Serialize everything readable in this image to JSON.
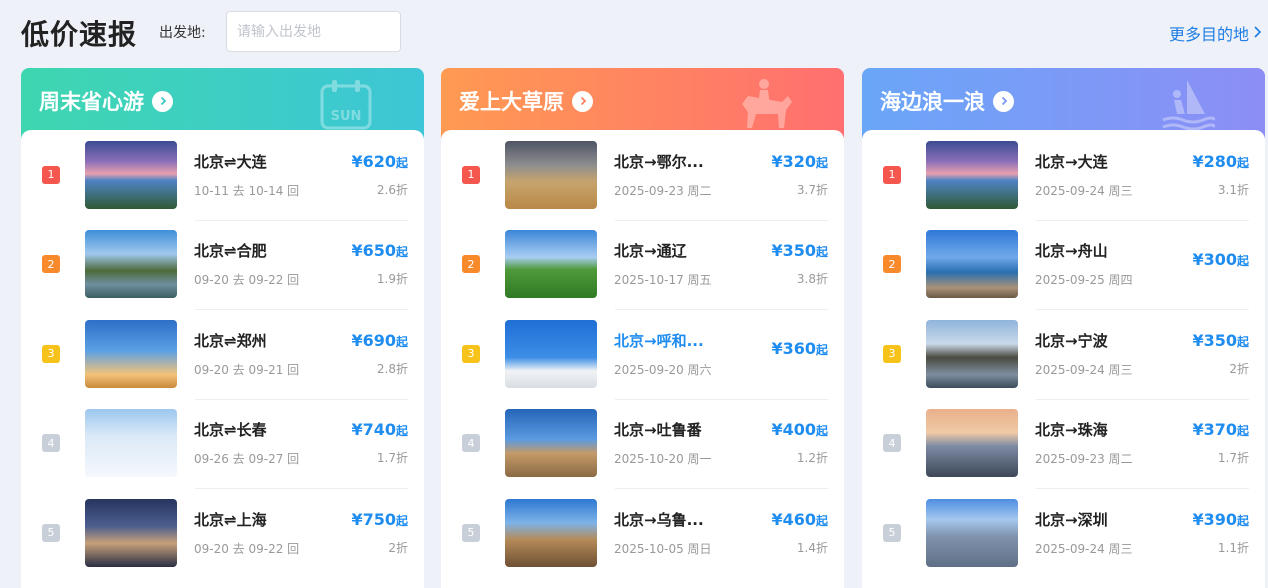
{
  "page": {
    "title": "低价速报",
    "origin_label": "出发地:",
    "origin_placeholder": "请输入出发地",
    "more_label": "更多目的地",
    "more_icon": "chevron-right-icon"
  },
  "cards": [
    {
      "title": "周末省心游",
      "deco_text": "SUN",
      "deco_icon": "calendar-sun-icon",
      "items": [
        {
          "rank": "1",
          "route": "北京⇌大连",
          "dates": "10-11 去 10-14 回",
          "price": "¥620",
          "suffix": "起",
          "discount": "2.6折"
        },
        {
          "rank": "2",
          "route": "北京⇌合肥",
          "dates": "09-20 去 09-22 回",
          "price": "¥650",
          "suffix": "起",
          "discount": "1.9折"
        },
        {
          "rank": "3",
          "route": "北京⇌郑州",
          "dates": "09-20 去 09-21 回",
          "price": "¥690",
          "suffix": "起",
          "discount": "2.8折"
        },
        {
          "rank": "4",
          "route": "北京⇌长春",
          "dates": "09-26 去 09-27 回",
          "price": "¥740",
          "suffix": "起",
          "discount": "1.7折"
        },
        {
          "rank": "5",
          "route": "北京⇌上海",
          "dates": "09-20 去 09-22 回",
          "price": "¥750",
          "suffix": "起",
          "discount": "2折"
        }
      ]
    },
    {
      "title": "爱上大草原",
      "deco_icon": "horse-rider-icon",
      "items": [
        {
          "rank": "1",
          "route": "北京→鄂尔...",
          "dates": "2025-09-23 周二",
          "price": "¥320",
          "suffix": "起",
          "discount": "3.7折"
        },
        {
          "rank": "2",
          "route": "北京→通辽",
          "dates": "2025-10-17 周五",
          "price": "¥350",
          "suffix": "起",
          "discount": "3.8折"
        },
        {
          "rank": "3",
          "route": "北京→呼和...",
          "dates": "2025-09-20 周六",
          "price": "¥360",
          "suffix": "起",
          "discount": ""
        },
        {
          "rank": "4",
          "route": "北京→吐鲁番",
          "dates": "2025-10-20 周一",
          "price": "¥400",
          "suffix": "起",
          "discount": "1.2折"
        },
        {
          "rank": "5",
          "route": "北京→乌鲁...",
          "dates": "2025-10-05 周日",
          "price": "¥460",
          "suffix": "起",
          "discount": "1.4折"
        }
      ]
    },
    {
      "title": "海边浪一浪",
      "deco_icon": "windsurfer-icon",
      "items": [
        {
          "rank": "1",
          "route": "北京→大连",
          "dates": "2025-09-24 周三",
          "price": "¥280",
          "suffix": "起",
          "discount": "3.1折"
        },
        {
          "rank": "2",
          "route": "北京→舟山",
          "dates": "2025-09-25 周四",
          "price": "¥300",
          "suffix": "起",
          "discount": ""
        },
        {
          "rank": "3",
          "route": "北京→宁波",
          "dates": "2025-09-24 周三",
          "price": "¥350",
          "suffix": "起",
          "discount": "2折"
        },
        {
          "rank": "4",
          "route": "北京→珠海",
          "dates": "2025-09-23 周二",
          "price": "¥370",
          "suffix": "起",
          "discount": "1.7折"
        },
        {
          "rank": "5",
          "route": "北京→深圳",
          "dates": "2025-09-24 周三",
          "price": "¥390",
          "suffix": "起",
          "discount": "1.1折"
        }
      ]
    }
  ],
  "colors": {
    "accent_blue": "#1f8cf0",
    "rank1": "#f5564e",
    "rank2": "#f88a2c",
    "rank3": "#f7c21a",
    "rank_other": "#c9cfd9"
  }
}
